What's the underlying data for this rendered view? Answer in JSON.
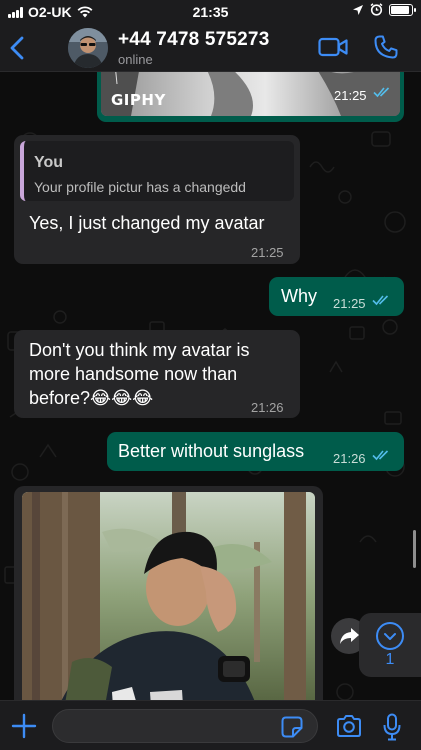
{
  "status_bar": {
    "carrier": "O2-UK",
    "time": "21:35"
  },
  "header": {
    "contact_name": "+44 7478 575273",
    "contact_status": "online"
  },
  "messages": [
    {
      "id": "gif",
      "direction": "outgoing",
      "type": "gif",
      "gif_label": "GIPHY",
      "time": "21:25",
      "status": "read"
    },
    {
      "id": "reply-avatar",
      "direction": "incoming",
      "type": "reply",
      "quoted_author": "You",
      "quoted_text": "Your profile pictur has a changedd",
      "text": "Yes, I just changed my avatar",
      "time": "21:25"
    },
    {
      "id": "why",
      "direction": "outgoing",
      "text": "Why",
      "time": "21:25",
      "status": "read"
    },
    {
      "id": "handsome",
      "direction": "incoming",
      "text_lines": [
        "Don't you think my avatar is",
        "more handsome now than",
        "before?😂😂😂"
      ],
      "time": "21:26"
    },
    {
      "id": "sunglass",
      "direction": "outgoing",
      "text": "Better without sunglass",
      "time": "21:26",
      "status": "read"
    },
    {
      "id": "photo",
      "direction": "incoming",
      "type": "image"
    }
  ],
  "scroll_down": {
    "unread_count": "1"
  },
  "composer": {
    "value": "",
    "placeholder": ""
  },
  "colors": {
    "accent": "#3d8cf5",
    "outgoing_bubble": "#005c4b",
    "incoming_bubble": "#262628",
    "read_ticks": "#53bdeb"
  }
}
